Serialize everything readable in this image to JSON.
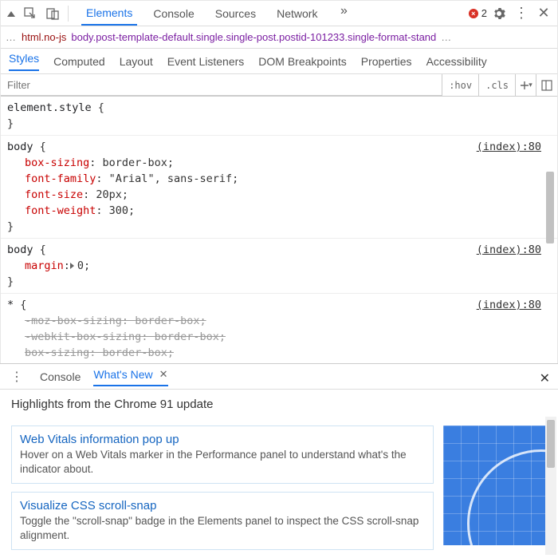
{
  "toolbar": {
    "tabs": [
      "Elements",
      "Console",
      "Sources",
      "Network"
    ],
    "active_tab_index": 0,
    "errors_count": "2"
  },
  "breadcrumb": {
    "more": "…",
    "item1": "html.no-js",
    "item2": "body.post-template-default.single.single-post.postid-101233.single-format-stand",
    "trailing": "…"
  },
  "subtabs": {
    "items": [
      "Styles",
      "Computed",
      "Layout",
      "Event Listeners",
      "DOM Breakpoints",
      "Properties",
      "Accessibility"
    ],
    "active_index": 0
  },
  "filter": {
    "placeholder": "Filter",
    "hov": ":hov",
    "cls": ".cls"
  },
  "rules": [
    {
      "selector": "element.style",
      "source": null,
      "decls": []
    },
    {
      "selector": "body",
      "source": "(index):80",
      "decls": [
        {
          "prop": "box-sizing",
          "val": "border-box;"
        },
        {
          "prop": "font-family",
          "val": "\"Arial\", sans-serif;"
        },
        {
          "prop": "font-size",
          "val": "20px;"
        },
        {
          "prop": "font-weight",
          "val": "300;"
        }
      ]
    },
    {
      "selector": "body",
      "source": "(index):80",
      "decls": [
        {
          "prop": "margin",
          "val": "0;",
          "expandable": true
        }
      ]
    },
    {
      "selector": "*",
      "source": "(index):80",
      "decls": [
        {
          "prop": "-moz-box-sizing",
          "val": "border-box;",
          "struck": true
        },
        {
          "prop": "-webkit-box-sizing",
          "val": "border-box;",
          "struck": true
        },
        {
          "prop": "box-sizing",
          "val": "border-box;",
          "struck": true
        }
      ]
    }
  ],
  "drawer": {
    "tabs": [
      "Console",
      "What's New"
    ],
    "active_index": 1,
    "headline": "Highlights from the Chrome 91 update",
    "cards": [
      {
        "title": "Web Vitals information pop up",
        "desc": "Hover on a Web Vitals marker in the Performance panel to understand what's the indicator about."
      },
      {
        "title": "Visualize CSS scroll-snap",
        "desc": "Toggle the \"scroll-snap\" badge in the Elements panel to inspect the CSS scroll-snap alignment."
      }
    ]
  }
}
